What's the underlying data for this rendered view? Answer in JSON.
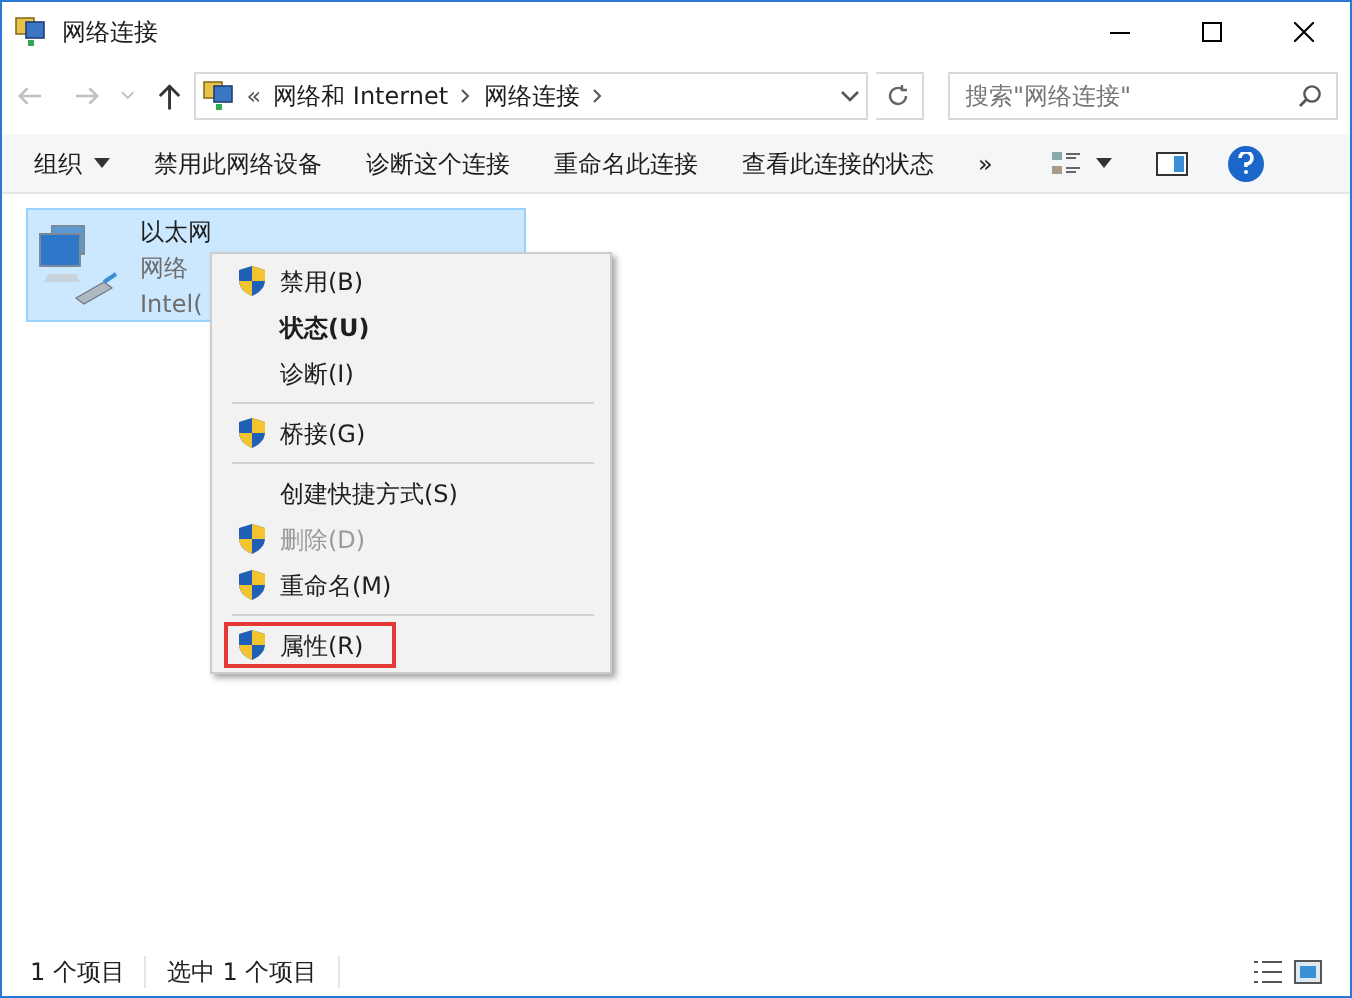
{
  "window": {
    "title": "网络连接"
  },
  "address_bar": {
    "prefix": "«",
    "crumbs": [
      "网络和 Internet",
      "网络连接"
    ]
  },
  "search": {
    "placeholder": "搜索\"网络连接\""
  },
  "toolbar": {
    "items": [
      {
        "label": "组织",
        "kind": "dropdown"
      },
      {
        "label": "禁用此网络设备",
        "kind": "plain"
      },
      {
        "label": "诊断这个连接",
        "kind": "plain"
      },
      {
        "label": "重命名此连接",
        "kind": "plain"
      },
      {
        "label": "查看此连接的状态",
        "kind": "plain"
      },
      {
        "label": "»",
        "kind": "plain"
      }
    ]
  },
  "items": [
    {
      "name": "以太网",
      "type": "网络",
      "device": "Intel(",
      "selected": true
    }
  ],
  "context_menu": [
    {
      "kind": "item",
      "label": "禁用(B)",
      "shield": true,
      "bold": false,
      "disabled": false,
      "highlighted": false
    },
    {
      "kind": "item",
      "label": "状态(U)",
      "shield": false,
      "bold": true,
      "disabled": false,
      "highlighted": false
    },
    {
      "kind": "item",
      "label": "诊断(I)",
      "shield": false,
      "bold": false,
      "disabled": false,
      "highlighted": false
    },
    {
      "kind": "separator"
    },
    {
      "kind": "item",
      "label": "桥接(G)",
      "shield": true,
      "bold": false,
      "disabled": false,
      "highlighted": false
    },
    {
      "kind": "separator"
    },
    {
      "kind": "item",
      "label": "创建快捷方式(S)",
      "shield": false,
      "bold": false,
      "disabled": false,
      "highlighted": false
    },
    {
      "kind": "item",
      "label": "删除(D)",
      "shield": true,
      "bold": false,
      "disabled": true,
      "highlighted": false
    },
    {
      "kind": "item",
      "label": "重命名(M)",
      "shield": true,
      "bold": false,
      "disabled": false,
      "highlighted": false
    },
    {
      "kind": "separator"
    },
    {
      "kind": "item",
      "label": "属性(R)",
      "shield": true,
      "bold": false,
      "disabled": false,
      "highlighted": true
    }
  ],
  "status_bar": {
    "count": "1 个项目",
    "selection": "选中 1 个项目"
  }
}
